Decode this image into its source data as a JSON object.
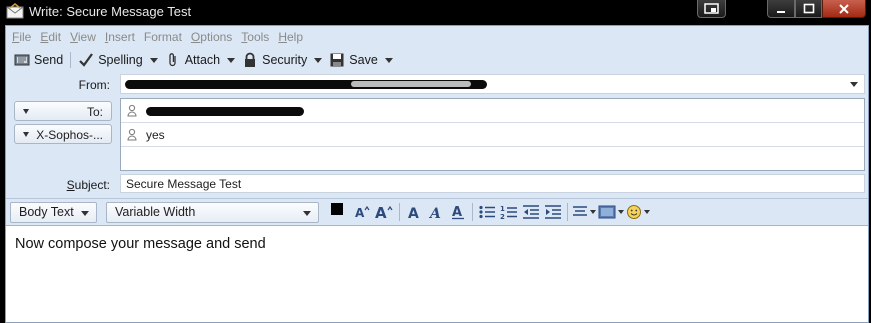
{
  "window": {
    "title": "Write: Secure Message Test"
  },
  "menu": {
    "items": [
      {
        "accel": "F",
        "rest": "ile"
      },
      {
        "accel": "E",
        "rest": "dit"
      },
      {
        "accel": "V",
        "rest": "iew"
      },
      {
        "accel": "I",
        "rest": "nsert"
      },
      {
        "accel": "",
        "rest": "Format"
      },
      {
        "accel": "O",
        "rest": "ptions"
      },
      {
        "accel": "T",
        "rest": "ools"
      },
      {
        "accel": "H",
        "rest": "elp"
      }
    ]
  },
  "toolbar": {
    "send": "Send",
    "spelling": "Spelling",
    "attach": "Attach",
    "security": "Security",
    "save": "Save"
  },
  "header": {
    "from_label": "From:",
    "to_label": "To:",
    "custom_label": "X-Sophos-...",
    "custom_value": "yes",
    "subject_label_accel": "S",
    "subject_label_rest": "ubject:",
    "subject_value": "Secure Message Test"
  },
  "format": {
    "paragraph_style": "Body Text",
    "font": "Variable Width"
  },
  "body": {
    "text": "Now compose your message and send"
  },
  "colors": {
    "frame_bg": "#dbe7f5",
    "accent_blue": "#2c4a7c",
    "close_red": "#b8412b"
  }
}
